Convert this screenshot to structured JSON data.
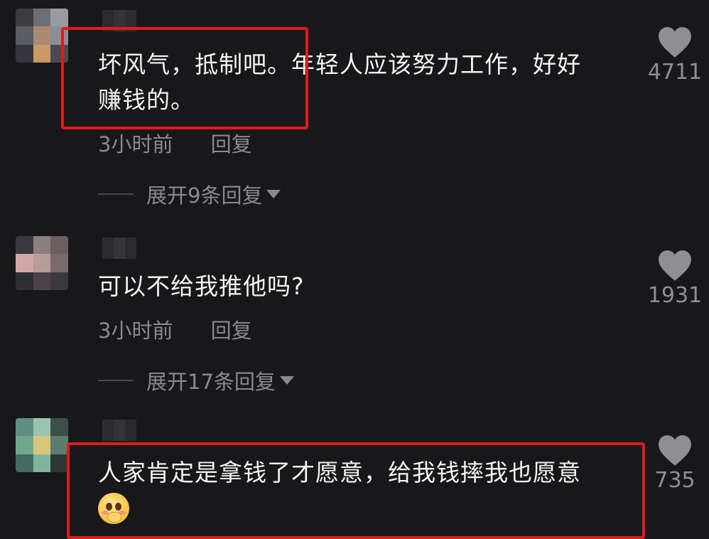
{
  "comments": [
    {
      "text_line1": "坏风气，抵制吧。年轻人应该努力工作，好好",
      "text_line2": "赚钱的。",
      "time": "3小时前",
      "reply_label": "回复",
      "expand_label": "展开9条回复",
      "likes": "4711",
      "highlighted": true
    },
    {
      "text_line1": "可以不给我推他吗?",
      "time": "3小时前",
      "reply_label": "回复",
      "expand_label": "展开17条回复",
      "likes": "1931",
      "highlighted": false
    },
    {
      "text_line1": "人家肯定是拿钱了才愿意，给我钱摔我也愿意",
      "emoji": "pleading-hands-emoji",
      "likes": "735",
      "highlighted": true
    }
  ],
  "colors": {
    "background": "#18181b",
    "text": "#f4f4f4",
    "secondary": "#8a8a8e",
    "highlight_border": "#e21a1a"
  },
  "icons": {
    "like": "heart-icon",
    "expand": "caret-down-icon",
    "avatar": "pixelated-avatar"
  }
}
